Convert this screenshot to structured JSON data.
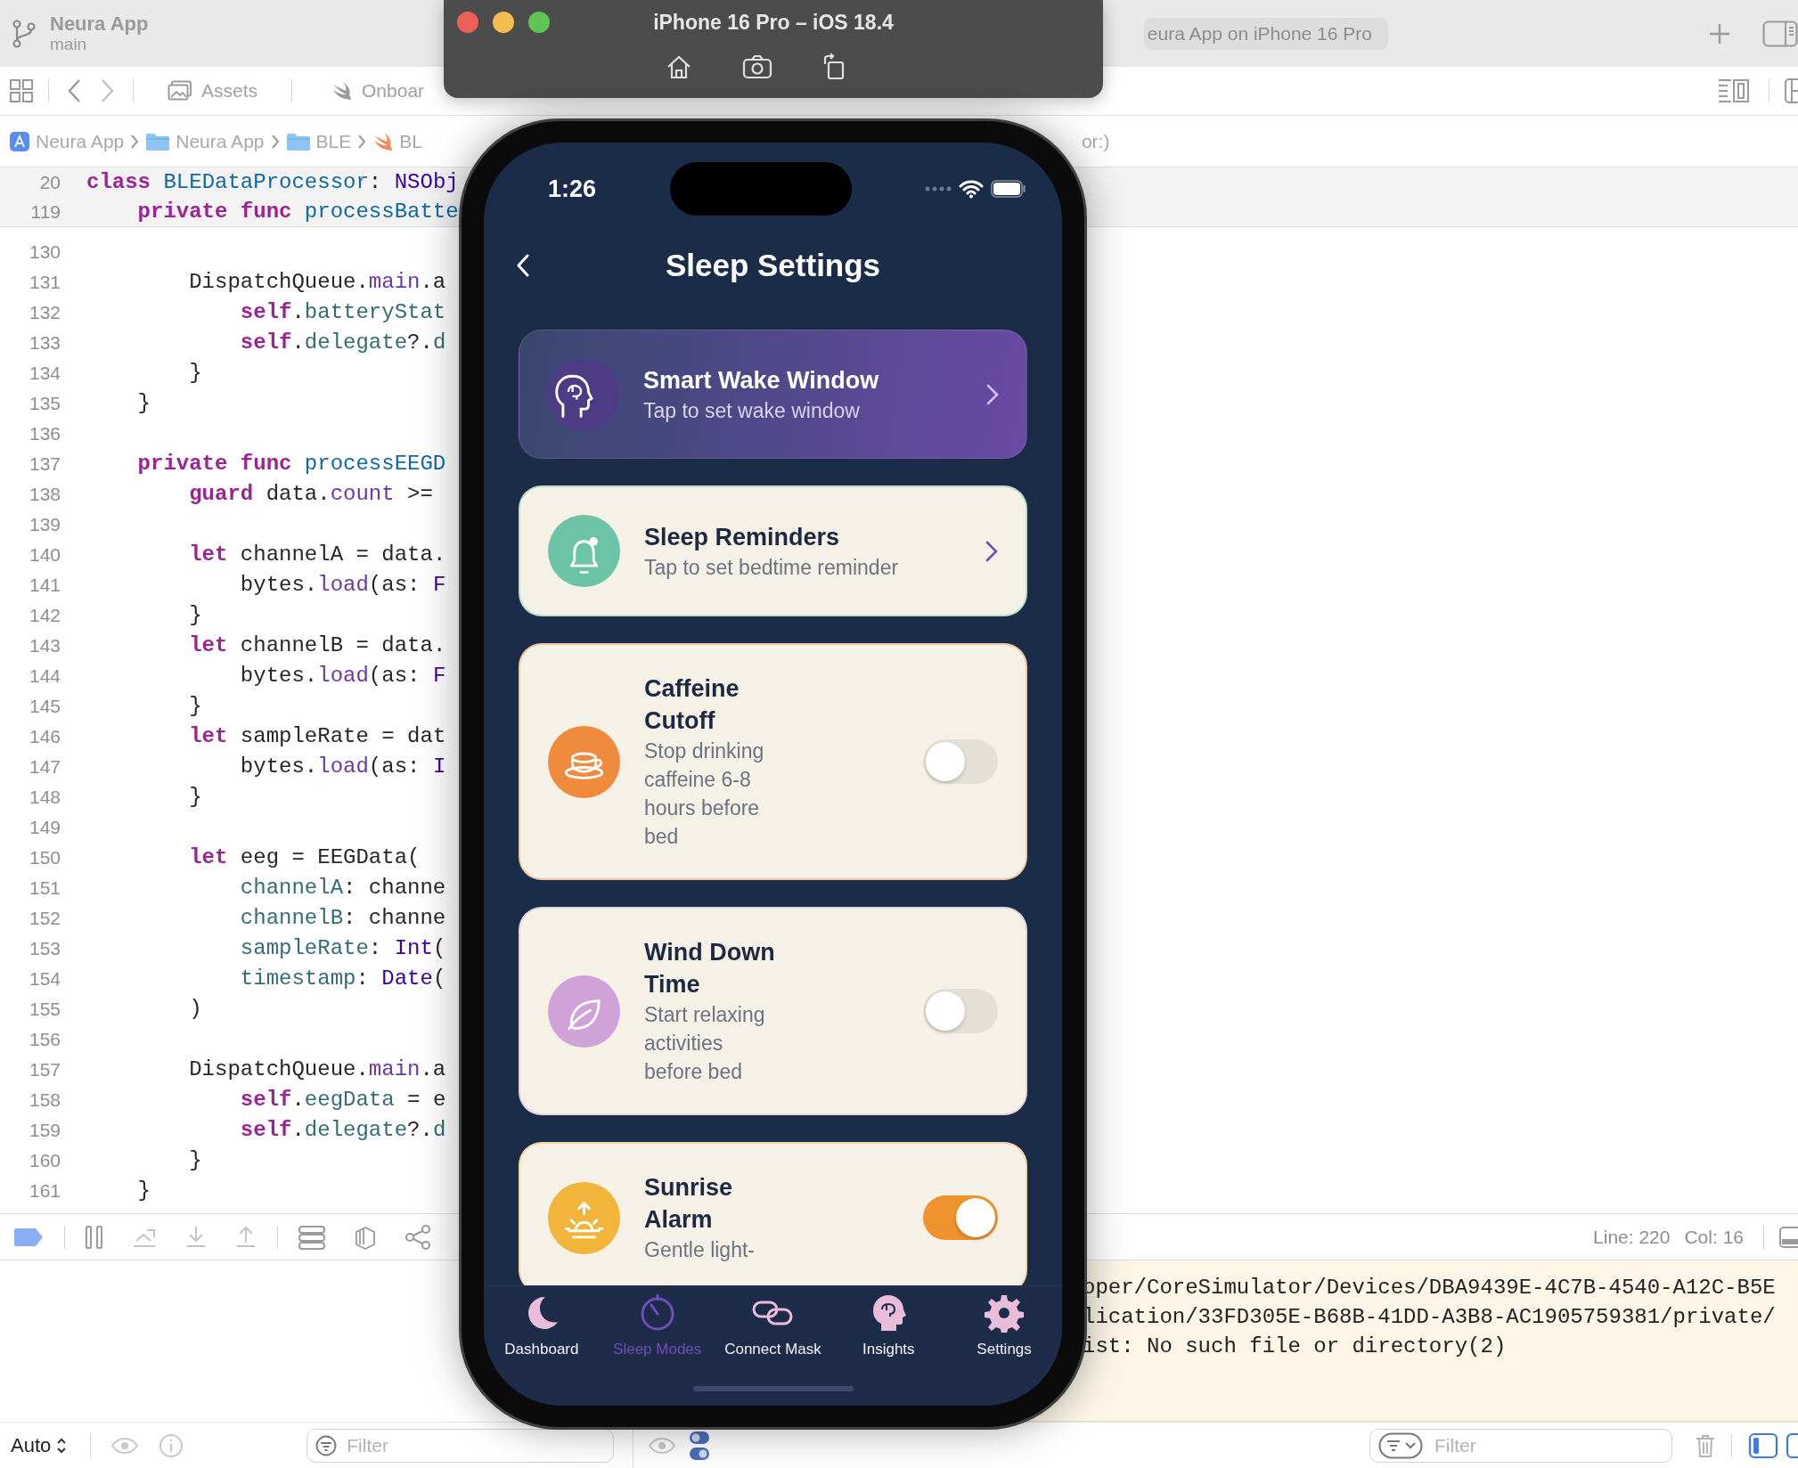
{
  "xcode": {
    "project": {
      "name": "Neura App",
      "branch": "main"
    },
    "run_destination": "eura App on iPhone 16 Pro",
    "editor_tabs": [
      {
        "label": "Assets",
        "kind": "assets",
        "selected": false
      },
      {
        "label": "Onboar",
        "kind": "swift",
        "selected": false
      }
    ],
    "breadcrumb": [
      {
        "label": "Neura App",
        "kind": "project"
      },
      {
        "label": "Neura App",
        "kind": "folder"
      },
      {
        "label": "BLE",
        "kind": "folder"
      },
      {
        "label": "BL",
        "kind": "swift"
      }
    ],
    "breadcrumb_tail": "or:)",
    "sticky_lines": [
      {
        "number": "20",
        "tokens": [
          {
            "text": "class ",
            "kind": "keyword"
          },
          {
            "text": "BLEDataProcessor",
            "kind": "declaration"
          },
          {
            "text": ": ",
            "kind": "plain"
          },
          {
            "text": "NSObj",
            "kind": "type"
          }
        ]
      },
      {
        "number": "119",
        "tokens": [
          {
            "text": "    private func ",
            "kind": "keyword"
          },
          {
            "text": "processBatte",
            "kind": "declaration"
          }
        ]
      }
    ],
    "code_lines": [
      {
        "number": "130"
      },
      {
        "number": "131",
        "tokens": [
          {
            "text": "        DispatchQueue.",
            "kind": "plain"
          },
          {
            "text": "main",
            "kind": "member"
          },
          {
            "text": ".a",
            "kind": "plain"
          }
        ]
      },
      {
        "number": "132",
        "tokens": [
          {
            "text": "            self",
            "kind": "keyword"
          },
          {
            "text": ".",
            "kind": "plain"
          },
          {
            "text": "batteryStat",
            "kind": "property"
          }
        ]
      },
      {
        "number": "133",
        "tokens": [
          {
            "text": "            self",
            "kind": "keyword"
          },
          {
            "text": ".",
            "kind": "plain"
          },
          {
            "text": "delegate",
            "kind": "property"
          },
          {
            "text": "?.",
            "kind": "plain"
          },
          {
            "text": "d",
            "kind": "property"
          }
        ]
      },
      {
        "number": "134",
        "tokens": [
          {
            "text": "        }",
            "kind": "plain"
          }
        ]
      },
      {
        "number": "135",
        "tokens": [
          {
            "text": "    }",
            "kind": "plain"
          }
        ]
      },
      {
        "number": "136"
      },
      {
        "number": "137",
        "tokens": [
          {
            "text": "    private func ",
            "kind": "keyword"
          },
          {
            "text": "processEEGD",
            "kind": "declaration"
          }
        ]
      },
      {
        "number": "138",
        "tokens": [
          {
            "text": "        guard",
            "kind": "keyword"
          },
          {
            "text": " data.",
            "kind": "plain"
          },
          {
            "text": "count",
            "kind": "member"
          },
          {
            "text": " >=",
            "kind": "plain"
          }
        ]
      },
      {
        "number": "139"
      },
      {
        "number": "140",
        "tokens": [
          {
            "text": "        let",
            "kind": "keyword"
          },
          {
            "text": " channelA = data.",
            "kind": "plain"
          }
        ]
      },
      {
        "number": "141",
        "tokens": [
          {
            "text": "            bytes.",
            "kind": "plain"
          },
          {
            "text": "load",
            "kind": "member"
          },
          {
            "text": "(as: ",
            "kind": "plain"
          },
          {
            "text": "F",
            "kind": "type"
          }
        ]
      },
      {
        "number": "142",
        "tokens": [
          {
            "text": "        }",
            "kind": "plain"
          }
        ]
      },
      {
        "number": "143",
        "tokens": [
          {
            "text": "        let",
            "kind": "keyword"
          },
          {
            "text": " channelB = data.",
            "kind": "plain"
          }
        ]
      },
      {
        "number": "144",
        "tokens": [
          {
            "text": "            bytes.",
            "kind": "plain"
          },
          {
            "text": "load",
            "kind": "member"
          },
          {
            "text": "(as: ",
            "kind": "plain"
          },
          {
            "text": "F",
            "kind": "type"
          }
        ]
      },
      {
        "number": "145",
        "tokens": [
          {
            "text": "        }",
            "kind": "plain"
          }
        ]
      },
      {
        "number": "146",
        "tokens": [
          {
            "text": "        let",
            "kind": "keyword"
          },
          {
            "text": " sampleRate = dat",
            "kind": "plain"
          }
        ]
      },
      {
        "number": "147",
        "tokens": [
          {
            "text": "            bytes.",
            "kind": "plain"
          },
          {
            "text": "load",
            "kind": "member"
          },
          {
            "text": "(as: ",
            "kind": "plain"
          },
          {
            "text": "I",
            "kind": "type"
          }
        ]
      },
      {
        "number": "148",
        "tokens": [
          {
            "text": "        }",
            "kind": "plain"
          }
        ]
      },
      {
        "number": "149"
      },
      {
        "number": "150",
        "tokens": [
          {
            "text": "        let",
            "kind": "keyword"
          },
          {
            "text": " eeg = EEGData(",
            "kind": "plain"
          }
        ]
      },
      {
        "number": "151",
        "tokens": [
          {
            "text": "            channelA",
            "kind": "property"
          },
          {
            "text": ": channe",
            "kind": "plain"
          }
        ]
      },
      {
        "number": "152",
        "tokens": [
          {
            "text": "            channelB",
            "kind": "property"
          },
          {
            "text": ": channe",
            "kind": "plain"
          }
        ]
      },
      {
        "number": "153",
        "tokens": [
          {
            "text": "            sampleRate",
            "kind": "property"
          },
          {
            "text": ": ",
            "kind": "plain"
          },
          {
            "text": "Int",
            "kind": "type"
          },
          {
            "text": "(",
            "kind": "plain"
          }
        ]
      },
      {
        "number": "154",
        "tokens": [
          {
            "text": "            timestamp",
            "kind": "property"
          },
          {
            "text": ": ",
            "kind": "plain"
          },
          {
            "text": "Date",
            "kind": "type"
          },
          {
            "text": "(",
            "kind": "plain"
          }
        ]
      },
      {
        "number": "155",
        "tokens": [
          {
            "text": "        )",
            "kind": "plain"
          }
        ]
      },
      {
        "number": "156"
      },
      {
        "number": "157",
        "tokens": [
          {
            "text": "        DispatchQueue.",
            "kind": "plain"
          },
          {
            "text": "main",
            "kind": "member"
          },
          {
            "text": ".a",
            "kind": "plain"
          }
        ]
      },
      {
        "number": "158",
        "tokens": [
          {
            "text": "            self",
            "kind": "keyword"
          },
          {
            "text": ".",
            "kind": "plain"
          },
          {
            "text": "eegData",
            "kind": "property"
          },
          {
            "text": " = e",
            "kind": "plain"
          }
        ]
      },
      {
        "number": "159",
        "tokens": [
          {
            "text": "            self",
            "kind": "keyword"
          },
          {
            "text": ".",
            "kind": "plain"
          },
          {
            "text": "delegate",
            "kind": "property"
          },
          {
            "text": "?.",
            "kind": "plain"
          },
          {
            "text": "d",
            "kind": "property"
          }
        ]
      },
      {
        "number": "160",
        "tokens": [
          {
            "text": "        }",
            "kind": "plain"
          }
        ]
      },
      {
        "number": "161",
        "tokens": [
          {
            "text": "    }",
            "kind": "plain"
          }
        ]
      }
    ],
    "cursor_position": {
      "line": "Line: 220",
      "column": "Col: 16"
    },
    "console_lines": [
      "oper/CoreSimulator/Devices/DBA9439E-4C7B-4540-A12C-B5E",
      "lication/33FD305E-B68B-41DD-A3B8-AC1905759381/private/",
      "ist: No such file or directory(2)"
    ],
    "variables_scope": "Auto",
    "variables_filter": {
      "placeholder": "Filter"
    },
    "console_filter": {
      "placeholder": "Filter"
    }
  },
  "simulator": {
    "title": "iPhone 16 Pro – iOS 18.4",
    "status_time": "1:26",
    "screen_title": "Sleep Settings",
    "cards": [
      {
        "kind": "featured",
        "title": "Smart Wake Window",
        "subtitle": "Tap to set wake window",
        "color": "#4d3b86"
      },
      {
        "kind": "link",
        "title": "Sleep Reminders",
        "subtitle": "Tap to set bedtime reminder",
        "color": "#6cc3a6"
      },
      {
        "kind": "toggle",
        "title": "Caffeine Cutoff",
        "subtitle": "Stop drinking caffeine 6-8 hours before bed",
        "color": "#f08a3c",
        "on": false
      },
      {
        "kind": "toggle",
        "title": "Wind Down Time",
        "subtitle": "Start relaxing activities before bed",
        "color": "#cfa2d8",
        "on": false
      },
      {
        "kind": "toggle",
        "title": "Sunrise Alarm",
        "subtitle": "Gentle light-",
        "color": "#f2b53a",
        "on": true
      }
    ],
    "tab_bar": [
      {
        "label": "Dashboard",
        "selected": false
      },
      {
        "label": "Sleep Modes",
        "selected": true
      },
      {
        "label": "Connect Mask",
        "selected": false
      },
      {
        "label": "Insights",
        "selected": false
      },
      {
        "label": "Settings",
        "selected": false
      }
    ]
  }
}
